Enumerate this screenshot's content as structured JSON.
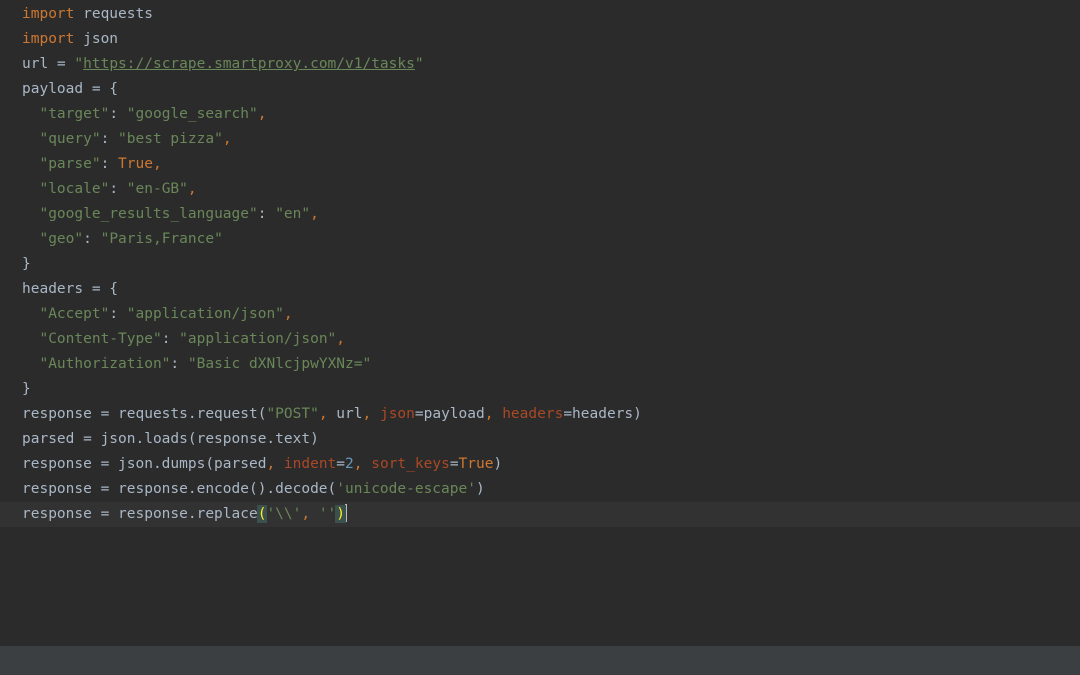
{
  "colors": {
    "background": "#2b2b2b",
    "current_line": "#323232",
    "keyword": "#cc7832",
    "string": "#6a8759",
    "kwarg": "#aa4926",
    "number": "#6897bb",
    "plain": "#a9b7c6",
    "status_bar": "#3c3f41"
  },
  "editor": {
    "current_line_index": 20,
    "lines": [
      [
        {
          "t": "import",
          "k": "keyword"
        },
        {
          "t": " requests",
          "k": "plain"
        }
      ],
      [
        {
          "t": "import",
          "k": "keyword"
        },
        {
          "t": " json",
          "k": "plain"
        }
      ],
      [
        {
          "t": "url = ",
          "k": "plain"
        },
        {
          "t": "\"",
          "k": "string"
        },
        {
          "t": "https://scrape.smartproxy.com/v1/tasks",
          "k": "string",
          "link": true
        },
        {
          "t": "\"",
          "k": "string"
        }
      ],
      [
        {
          "t": "payload = {",
          "k": "plain"
        }
      ],
      [
        {
          "t": "  ",
          "k": "plain"
        },
        {
          "t": "\"target\"",
          "k": "string"
        },
        {
          "t": ": ",
          "k": "plain"
        },
        {
          "t": "\"google_search\"",
          "k": "string"
        },
        {
          "t": ",",
          "k": "keyword"
        }
      ],
      [
        {
          "t": "  ",
          "k": "plain"
        },
        {
          "t": "\"query\"",
          "k": "string"
        },
        {
          "t": ": ",
          "k": "plain"
        },
        {
          "t": "\"best pizza\"",
          "k": "string"
        },
        {
          "t": ",",
          "k": "keyword"
        }
      ],
      [
        {
          "t": "  ",
          "k": "plain"
        },
        {
          "t": "\"parse\"",
          "k": "string"
        },
        {
          "t": ": ",
          "k": "plain"
        },
        {
          "t": "True",
          "k": "keyword"
        },
        {
          "t": ",",
          "k": "keyword"
        }
      ],
      [
        {
          "t": "  ",
          "k": "plain"
        },
        {
          "t": "\"locale\"",
          "k": "string"
        },
        {
          "t": ": ",
          "k": "plain"
        },
        {
          "t": "\"en-GB\"",
          "k": "string"
        },
        {
          "t": ",",
          "k": "keyword"
        }
      ],
      [
        {
          "t": "  ",
          "k": "plain"
        },
        {
          "t": "\"google_results_language\"",
          "k": "string"
        },
        {
          "t": ": ",
          "k": "plain"
        },
        {
          "t": "\"en\"",
          "k": "string"
        },
        {
          "t": ",",
          "k": "keyword"
        }
      ],
      [
        {
          "t": "  ",
          "k": "plain"
        },
        {
          "t": "\"geo\"",
          "k": "string"
        },
        {
          "t": ": ",
          "k": "plain"
        },
        {
          "t": "\"Paris,France\"",
          "k": "string"
        }
      ],
      [
        {
          "t": "}",
          "k": "plain"
        }
      ],
      [
        {
          "t": "headers = {",
          "k": "plain"
        }
      ],
      [
        {
          "t": "  ",
          "k": "plain"
        },
        {
          "t": "\"Accept\"",
          "k": "string"
        },
        {
          "t": ": ",
          "k": "plain"
        },
        {
          "t": "\"application/json\"",
          "k": "string"
        },
        {
          "t": ",",
          "k": "keyword"
        }
      ],
      [
        {
          "t": "  ",
          "k": "plain"
        },
        {
          "t": "\"Content-Type\"",
          "k": "string"
        },
        {
          "t": ": ",
          "k": "plain"
        },
        {
          "t": "\"application/json\"",
          "k": "string"
        },
        {
          "t": ",",
          "k": "keyword"
        }
      ],
      [
        {
          "t": "  ",
          "k": "plain"
        },
        {
          "t": "\"Authorization\"",
          "k": "string"
        },
        {
          "t": ": ",
          "k": "plain"
        },
        {
          "t": "\"Basic dXNlcjpwYXNz=\"",
          "k": "string"
        }
      ],
      [
        {
          "t": "}",
          "k": "plain"
        }
      ],
      [
        {
          "t": "response = requests.request(",
          "k": "plain"
        },
        {
          "t": "\"POST\"",
          "k": "string"
        },
        {
          "t": ", ",
          "k": "keyword"
        },
        {
          "t": "url",
          "k": "plain"
        },
        {
          "t": ", ",
          "k": "keyword"
        },
        {
          "t": "json",
          "k": "kwarg"
        },
        {
          "t": "=payload",
          "k": "plain"
        },
        {
          "t": ", ",
          "k": "keyword"
        },
        {
          "t": "headers",
          "k": "kwarg"
        },
        {
          "t": "=headers)",
          "k": "plain"
        }
      ],
      [
        {
          "t": "parsed = json.loads(response.text)",
          "k": "plain"
        }
      ],
      [
        {
          "t": "response = json.dumps(parsed",
          "k": "plain"
        },
        {
          "t": ", ",
          "k": "keyword"
        },
        {
          "t": "indent",
          "k": "kwarg"
        },
        {
          "t": "=",
          "k": "plain"
        },
        {
          "t": "2",
          "k": "number"
        },
        {
          "t": ", ",
          "k": "keyword"
        },
        {
          "t": "sort_keys",
          "k": "kwarg"
        },
        {
          "t": "=",
          "k": "plain"
        },
        {
          "t": "True",
          "k": "keyword"
        },
        {
          "t": ")",
          "k": "plain"
        }
      ],
      [
        {
          "t": "response = response.encode().decode(",
          "k": "plain"
        },
        {
          "t": "'unicode-escape'",
          "k": "string"
        },
        {
          "t": ")",
          "k": "plain"
        }
      ],
      [
        {
          "t": "response = response.replace",
          "k": "plain"
        },
        {
          "t": "(",
          "k": "plain",
          "match": true
        },
        {
          "t": "'\\\\'",
          "k": "string"
        },
        {
          "t": ", ",
          "k": "keyword"
        },
        {
          "t": "''",
          "k": "string"
        },
        {
          "t": ")",
          "k": "plain",
          "match": true
        }
      ]
    ]
  }
}
